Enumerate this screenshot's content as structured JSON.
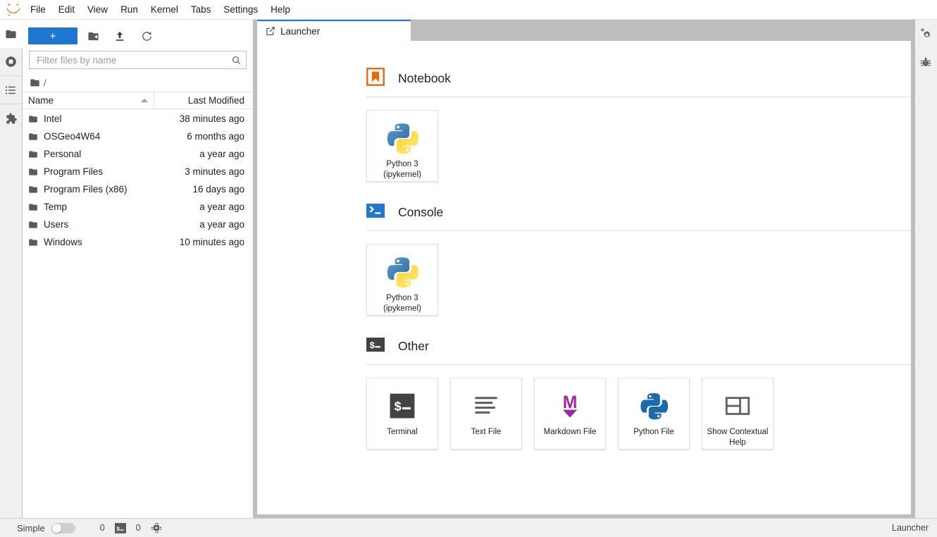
{
  "app": {
    "logo": "jupyter-logo",
    "window_title": "JupyterLab"
  },
  "menubar": {
    "items": [
      {
        "label": "File"
      },
      {
        "label": "Edit"
      },
      {
        "label": "View"
      },
      {
        "label": "Run"
      },
      {
        "label": "Kernel"
      },
      {
        "label": "Tabs"
      },
      {
        "label": "Settings"
      },
      {
        "label": "Help"
      }
    ]
  },
  "left_activity_bar": {
    "items": [
      {
        "name": "file-browser-icon",
        "label": "File Browser",
        "active": true
      },
      {
        "name": "running-terminals-icon",
        "label": "Running Terminals and Kernels",
        "active": false
      },
      {
        "name": "table-of-contents-icon",
        "label": "Table of Contents",
        "active": false
      },
      {
        "name": "extension-manager-icon",
        "label": "Extension Manager",
        "active": false
      }
    ]
  },
  "right_activity_bar": {
    "items": [
      {
        "name": "property-inspector-icon",
        "label": "Property Inspector"
      },
      {
        "name": "debugger-icon",
        "label": "Debugger"
      }
    ]
  },
  "file_browser": {
    "toolbar": {
      "new_launcher_label": "+",
      "new_folder_label": "New Folder",
      "upload_label": "Upload Files",
      "refresh_label": "Refresh File List"
    },
    "filter": {
      "placeholder": "Filter files by name",
      "value": ""
    },
    "breadcrumb": {
      "path": "/"
    },
    "columns": {
      "name": "Name",
      "last_modified": "Last Modified",
      "sort_column": "Name",
      "sort_direction": "ascending"
    },
    "rows": [
      {
        "name": "Intel",
        "modified": "38 minutes ago",
        "type": "folder"
      },
      {
        "name": "OSGeo4W64",
        "modified": "6 months ago",
        "type": "folder"
      },
      {
        "name": "Personal",
        "modified": "a year ago",
        "type": "folder"
      },
      {
        "name": "Program Files",
        "modified": "3 minutes ago",
        "type": "folder"
      },
      {
        "name": "Program Files (x86)",
        "modified": "16 days ago",
        "type": "folder"
      },
      {
        "name": "Temp",
        "modified": "a year ago",
        "type": "folder"
      },
      {
        "name": "Users",
        "modified": "a year ago",
        "type": "folder"
      },
      {
        "name": "Windows",
        "modified": "10 minutes ago",
        "type": "folder"
      }
    ]
  },
  "tabbar": {
    "tabs": [
      {
        "label": "Launcher",
        "icon": "launcher-icon",
        "active": true
      }
    ]
  },
  "launcher": {
    "sections": [
      {
        "title": "Notebook",
        "icon": "notebook-icon",
        "cards": [
          {
            "label": "Python 3\n(ipykernel)",
            "line1": "Python 3",
            "line2": "(ipykernel)",
            "icon": "python-logo-icon"
          }
        ]
      },
      {
        "title": "Console",
        "icon": "console-icon",
        "cards": [
          {
            "label": "Python 3\n(ipykernel)",
            "line1": "Python 3",
            "line2": "(ipykernel)",
            "icon": "python-logo-icon"
          }
        ]
      },
      {
        "title": "Other",
        "icon": "terminal-icon",
        "cards": [
          {
            "label": "Terminal",
            "line1": "Terminal",
            "line2": "",
            "icon": "terminal-icon"
          },
          {
            "label": "Text File",
            "line1": "Text File",
            "line2": "",
            "icon": "text-file-icon"
          },
          {
            "label": "Markdown File",
            "line1": "Markdown File",
            "line2": "",
            "icon": "markdown-icon"
          },
          {
            "label": "Python File",
            "line1": "Python File",
            "line2": "",
            "icon": "python-file-icon"
          },
          {
            "label": "Show Contextual Help",
            "line1": "Show Contextual",
            "line2": "Help",
            "icon": "contextual-help-icon"
          }
        ]
      }
    ]
  },
  "statusbar": {
    "simple_label": "Simple",
    "simple_enabled": false,
    "kernel_count": "0",
    "terminal_count": "0",
    "terminal_icon": "terminal-icon",
    "kernel_icon": "kernel-chip-icon",
    "active_item": "Launcher"
  },
  "colors": {
    "accent_blue": "#1f77d0",
    "notebook_orange": "#e8690b",
    "console_blue": "#1f77d0",
    "markdown_purple": "#a625a4",
    "python_blue": "#306998",
    "python_yellow": "#ffd43b",
    "terminal_dark": "#424242",
    "chrome_gray": "#f0f0f0",
    "tabbar_gray": "#bdbdbd"
  }
}
